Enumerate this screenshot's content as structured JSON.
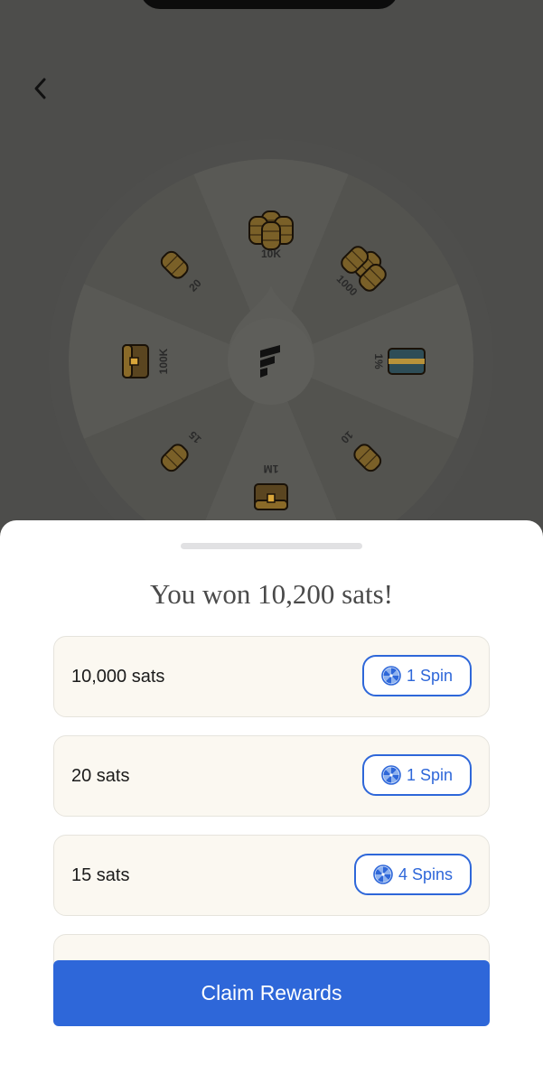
{
  "colors": {
    "overlay": "#4d4d4b",
    "sheet": "#ffffff",
    "row_bg": "#fbf8f1",
    "accent": "#2e67d9",
    "coin": "#d9a63a"
  },
  "icons": {
    "back": "chevron-left-icon",
    "spin": "pinwheel-icon",
    "logo": "fold-logo-icon"
  },
  "wheel": {
    "segments": [
      {
        "label": "10K",
        "prize": "coin-stack"
      },
      {
        "label": "1000",
        "prize": "coin-pile"
      },
      {
        "label": "1%",
        "prize": "gift-card"
      },
      {
        "label": "10",
        "prize": "coin-pair"
      },
      {
        "label": "1M",
        "prize": "treasure-chest"
      },
      {
        "label": "15",
        "prize": "coin-pair"
      },
      {
        "label": "100K",
        "prize": "treasure-chest"
      },
      {
        "label": "20",
        "prize": "coin-pair"
      }
    ]
  },
  "sheet": {
    "title": "You won 10,200 sats!",
    "rewards": [
      {
        "label": "10,000 sats",
        "spins": "1 Spin"
      },
      {
        "label": "20 sats",
        "spins": "1 Spin"
      },
      {
        "label": "15 sats",
        "spins": "4 Spins"
      },
      {
        "label": "",
        "spins": ""
      }
    ],
    "claim_label": "Claim Rewards"
  }
}
